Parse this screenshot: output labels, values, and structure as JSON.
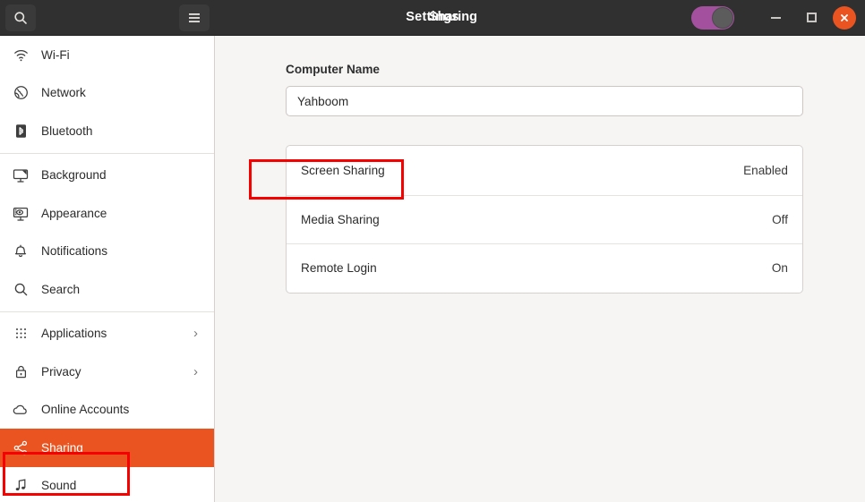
{
  "window": {
    "app_title": "Settings",
    "page_title": "Sharing",
    "search_icon": "search-icon",
    "menu_icon": "hamburger-menu-icon",
    "minimize_label": "Minimize",
    "maximize_label": "Maximize",
    "close_label": "Close",
    "toggle_state": "on",
    "colors": {
      "titlebar_bg": "#303030",
      "accent_orange": "#e95420",
      "toggle_purple": "#a3519f",
      "annotation_red": "#f60000"
    }
  },
  "sidebar": {
    "items": [
      {
        "label": "Wi-Fi",
        "icon": "wifi-icon",
        "chevron": "",
        "selected": false
      },
      {
        "label": "Network",
        "icon": "globe-icon",
        "chevron": "",
        "selected": false
      },
      {
        "label": "Bluetooth",
        "icon": "bluetooth-icon",
        "chevron": "",
        "selected": false
      },
      {
        "label": "Background",
        "icon": "monitor-image-icon",
        "chevron": "",
        "selected": false
      },
      {
        "label": "Appearance",
        "icon": "appearance-icon",
        "chevron": "",
        "selected": false
      },
      {
        "label": "Notifications",
        "icon": "bell-icon",
        "chevron": "",
        "selected": false
      },
      {
        "label": "Search",
        "icon": "magnifier-icon",
        "chevron": "",
        "selected": false
      },
      {
        "label": "Applications",
        "icon": "grid-dots-icon",
        "chevron": "›",
        "selected": false
      },
      {
        "label": "Privacy",
        "icon": "lock-icon",
        "chevron": "›",
        "selected": false
      },
      {
        "label": "Online Accounts",
        "icon": "cloud-icon",
        "chevron": "",
        "selected": false
      },
      {
        "label": "Sharing",
        "icon": "share-nodes-icon",
        "chevron": "",
        "selected": true
      },
      {
        "label": "Sound",
        "icon": "music-note-icon",
        "chevron": "",
        "selected": false
      }
    ]
  },
  "main": {
    "computer_name_label": "Computer Name",
    "computer_name_value": "Yahboom",
    "computer_name_placeholder": "Computer Name",
    "rows": [
      {
        "label": "Screen Sharing",
        "value": "Enabled"
      },
      {
        "label": "Media Sharing",
        "value": "Off"
      },
      {
        "label": "Remote Login",
        "value": "On"
      }
    ]
  },
  "annotations": [
    {
      "target": "sidebar-item-sharing",
      "color": "#f60000"
    },
    {
      "target": "row-screen-sharing",
      "color": "#f60000"
    }
  ]
}
